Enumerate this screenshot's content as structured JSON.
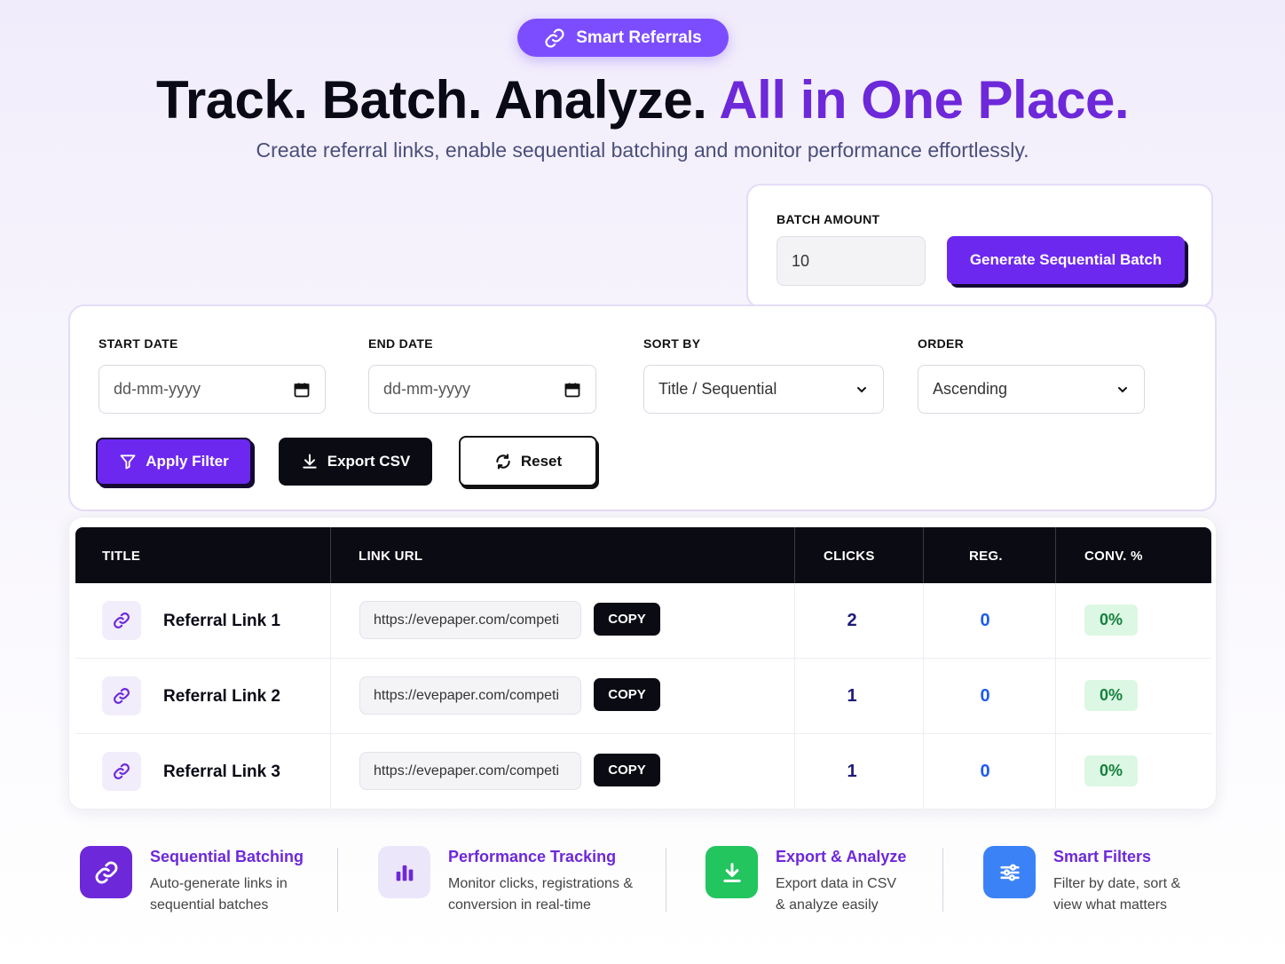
{
  "badge": {
    "label": "Smart Referrals",
    "icon": "link-icon"
  },
  "hero": {
    "headline_main": "Track. Batch. Analyze.",
    "headline_accent": "All in One Place.",
    "subtitle": "Create referral links, enable sequential batching and monitor performance effortlessly."
  },
  "batch": {
    "label": "BATCH AMOUNT",
    "value": "10",
    "button": "Generate Sequential Batch"
  },
  "filters": {
    "start_date": {
      "label": "START DATE",
      "placeholder": "dd-mm-yyyy"
    },
    "end_date": {
      "label": "END DATE",
      "placeholder": "dd-mm-yyyy"
    },
    "sort_by": {
      "label": "SORT BY",
      "value": "Title / Sequential"
    },
    "order": {
      "label": "ORDER",
      "value": "Ascending"
    },
    "apply_button": "Apply Filter",
    "export_button": "Export CSV",
    "reset_button": "Reset"
  },
  "table": {
    "headers": [
      "TITLE",
      "LINK URL",
      "CLICKS",
      "REG.",
      "CONV. %"
    ],
    "rows": [
      {
        "title": "Referral Link 1",
        "url": "https://evepaper.com/competi",
        "copy": "COPY",
        "clicks": "2",
        "reg": "0",
        "conv": "0%"
      },
      {
        "title": "Referral Link 2",
        "url": "https://evepaper.com/competi",
        "copy": "COPY",
        "clicks": "1",
        "reg": "0",
        "conv": "0%"
      },
      {
        "title": "Referral Link 3",
        "url": "https://evepaper.com/competi",
        "copy": "COPY",
        "clicks": "1",
        "reg": "0",
        "conv": "0%"
      }
    ]
  },
  "features": [
    {
      "title": "Sequential Batching",
      "desc": "Auto-generate links in sequential batches",
      "icon": "link-icon",
      "color": "#6d28d9"
    },
    {
      "title": "Performance Tracking",
      "desc": "Monitor clicks, registrations & conversion in real-time",
      "icon": "bar-chart-icon",
      "color": "#6d28d9"
    },
    {
      "title": "Export & Analyze",
      "desc": "Export data in CSV & analyze easily",
      "icon": "download-icon",
      "color": "#6d28d9"
    },
    {
      "title": "Smart Filters",
      "desc": "Filter by date, sort & view what matters",
      "icon": "sliders-icon",
      "color": "#6d28d9"
    }
  ],
  "colors": {
    "accent": "#6d28f0",
    "dark": "#0b0b14",
    "success_bg": "#dcf7e3",
    "success_text": "#15803d",
    "export_green": "#22c55e",
    "filters_blue": "#3b82f6"
  }
}
